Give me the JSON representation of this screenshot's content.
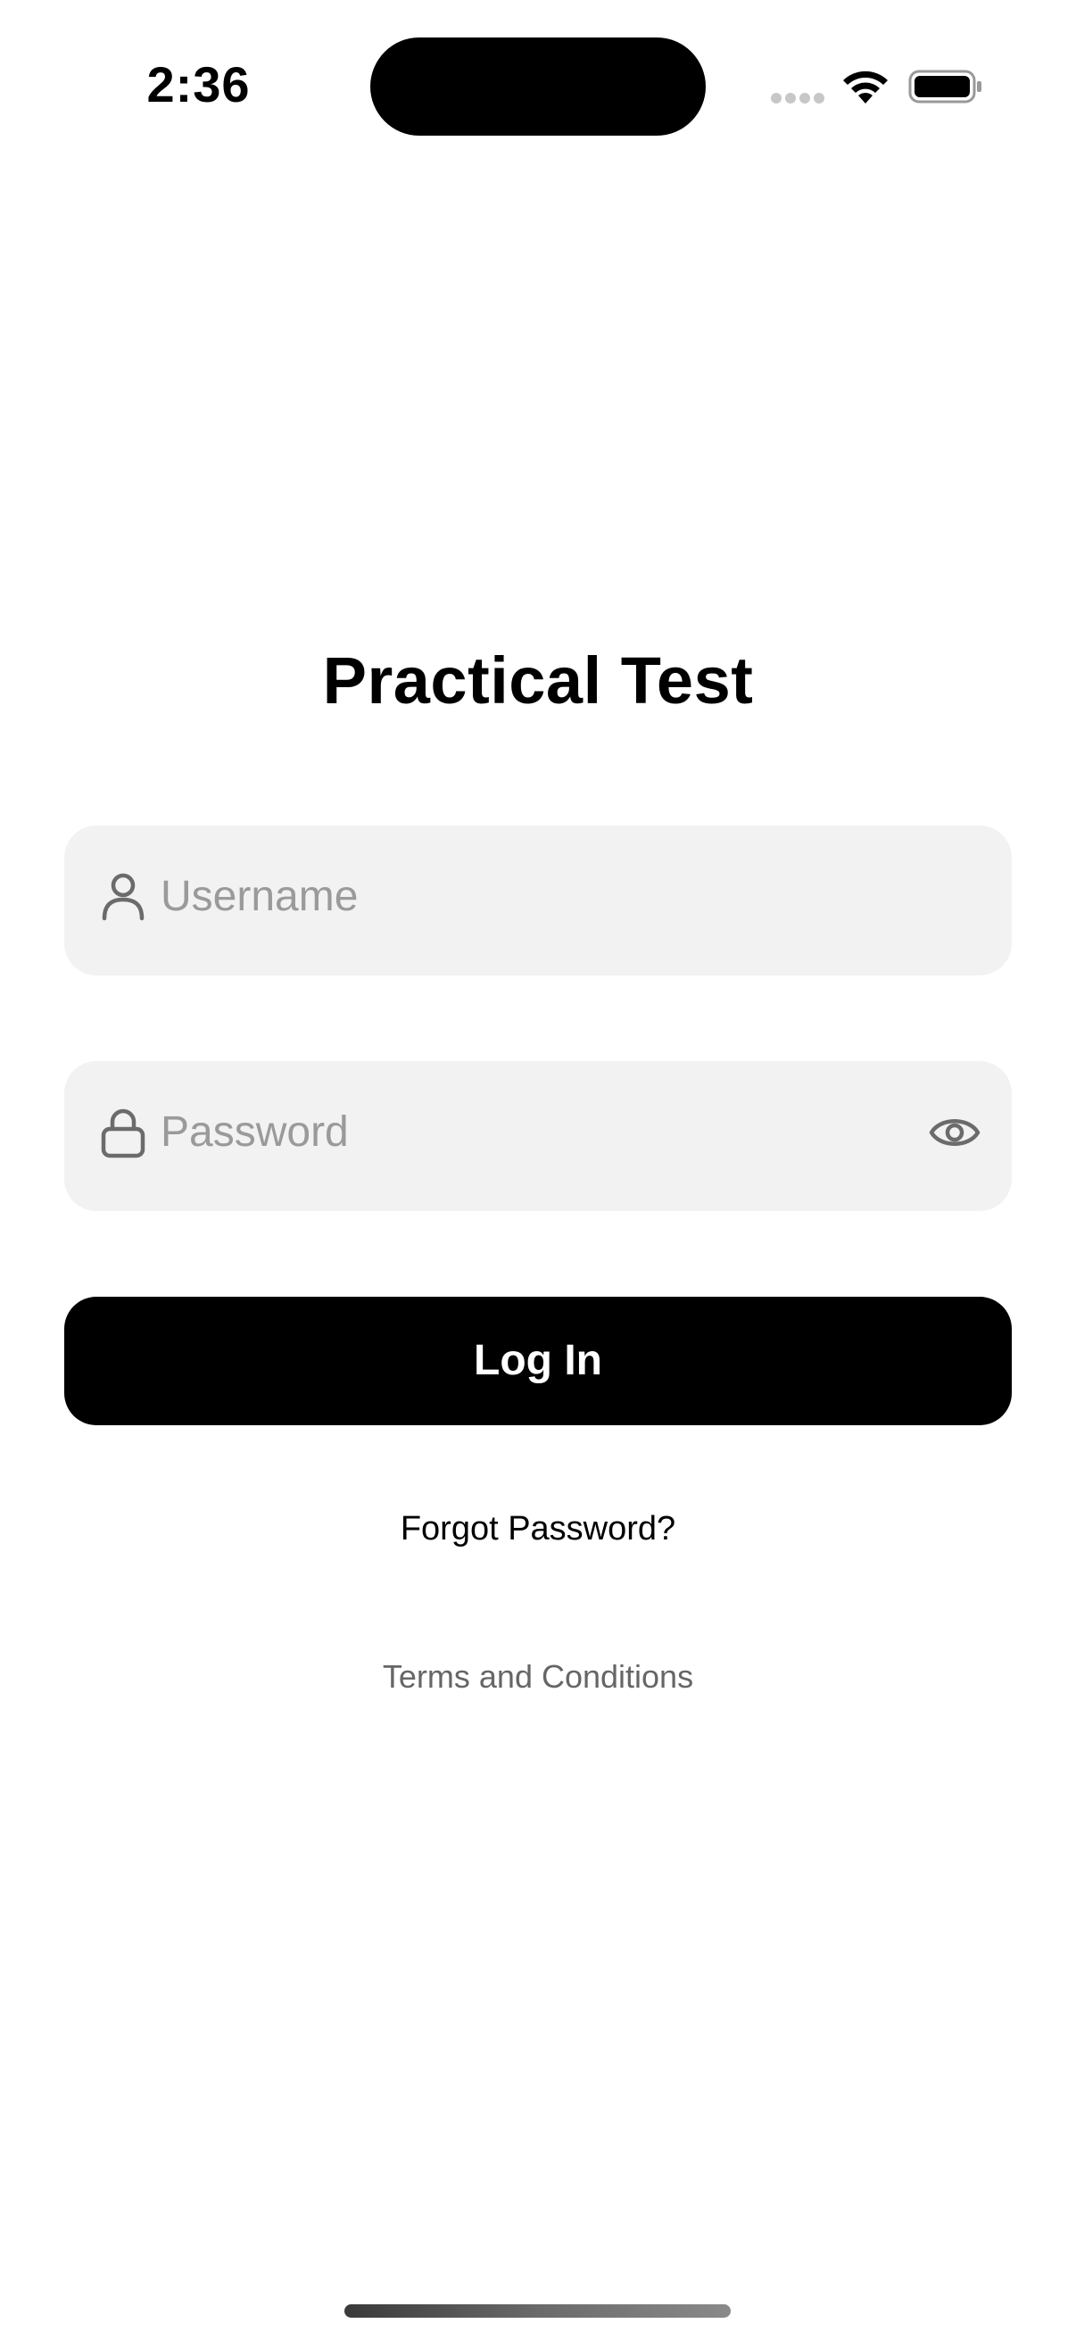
{
  "status_bar": {
    "time": "2:36"
  },
  "title": "Practical Test",
  "username_field": {
    "placeholder": "Username",
    "icon": "person-icon"
  },
  "password_field": {
    "placeholder": "Password",
    "icon": "lock-icon",
    "toggle_icon": "eye-icon"
  },
  "login_button": {
    "label": "Log In"
  },
  "forgot_password": "Forgot Password?",
  "terms": "Terms and Conditions",
  "colors": {
    "field_background": "#f2f2f2",
    "placeholder_text": "#9a9a9a",
    "button_background": "#000000",
    "button_text": "#ffffff",
    "secondary_text": "#666666"
  }
}
